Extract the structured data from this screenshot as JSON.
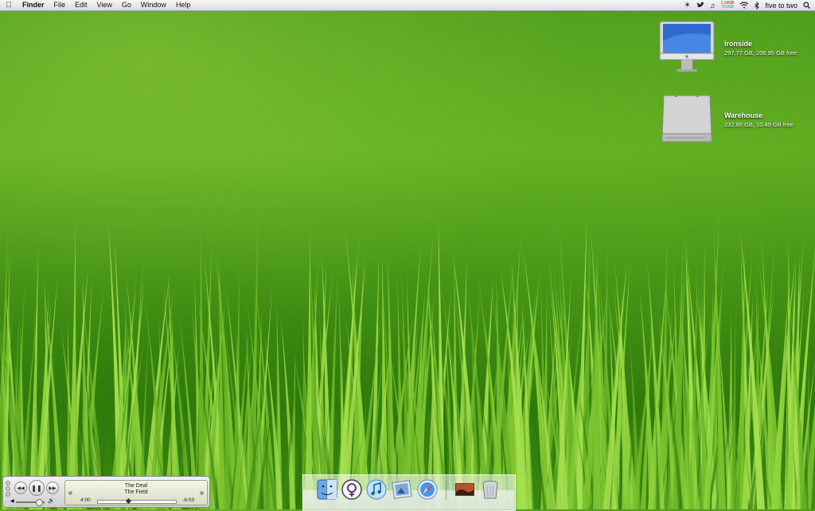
{
  "menubar": {
    "apple_icon": "apple-logo-icon",
    "items": [
      "Finder",
      "File",
      "Edit",
      "View",
      "Go",
      "Window",
      "Help"
    ],
    "status_icons": [
      "brightness-icon",
      "twitter-bird-icon",
      "music-note-icon"
    ],
    "memory": {
      "used": "1.24GB",
      "free": "761MB"
    },
    "wifi_icon": "wifi-icon",
    "bluetooth_icon": "bluetooth-icon",
    "clock": "five to two",
    "spotlight_icon": "spotlight-search-icon"
  },
  "desktop": {
    "icons": [
      {
        "name": "Ironside",
        "info": "297.77 GB, 206.95 GB free",
        "icon": "imac-icon"
      },
      {
        "name": "Warehouse",
        "info": "232.86 GB, 10.49 GB free",
        "icon": "hard-drive-icon"
      }
    ]
  },
  "itunes": {
    "song": "The Deal",
    "artist": "The Field",
    "elapsed": "4:00",
    "remaining": "-6:03",
    "progress": 0.39,
    "volume": 0.8
  },
  "dock": {
    "items": [
      "finder-icon",
      "adium-icon",
      "itunes-icon",
      "preview-icon",
      "safari-icon",
      "photos-stack-icon",
      "trash-icon"
    ]
  },
  "colors": {
    "accent": "#6fb32a",
    "menubar": "#e8e8e8",
    "grass_dark": "#2f7a0c",
    "grass_light": "#8fd23c"
  }
}
